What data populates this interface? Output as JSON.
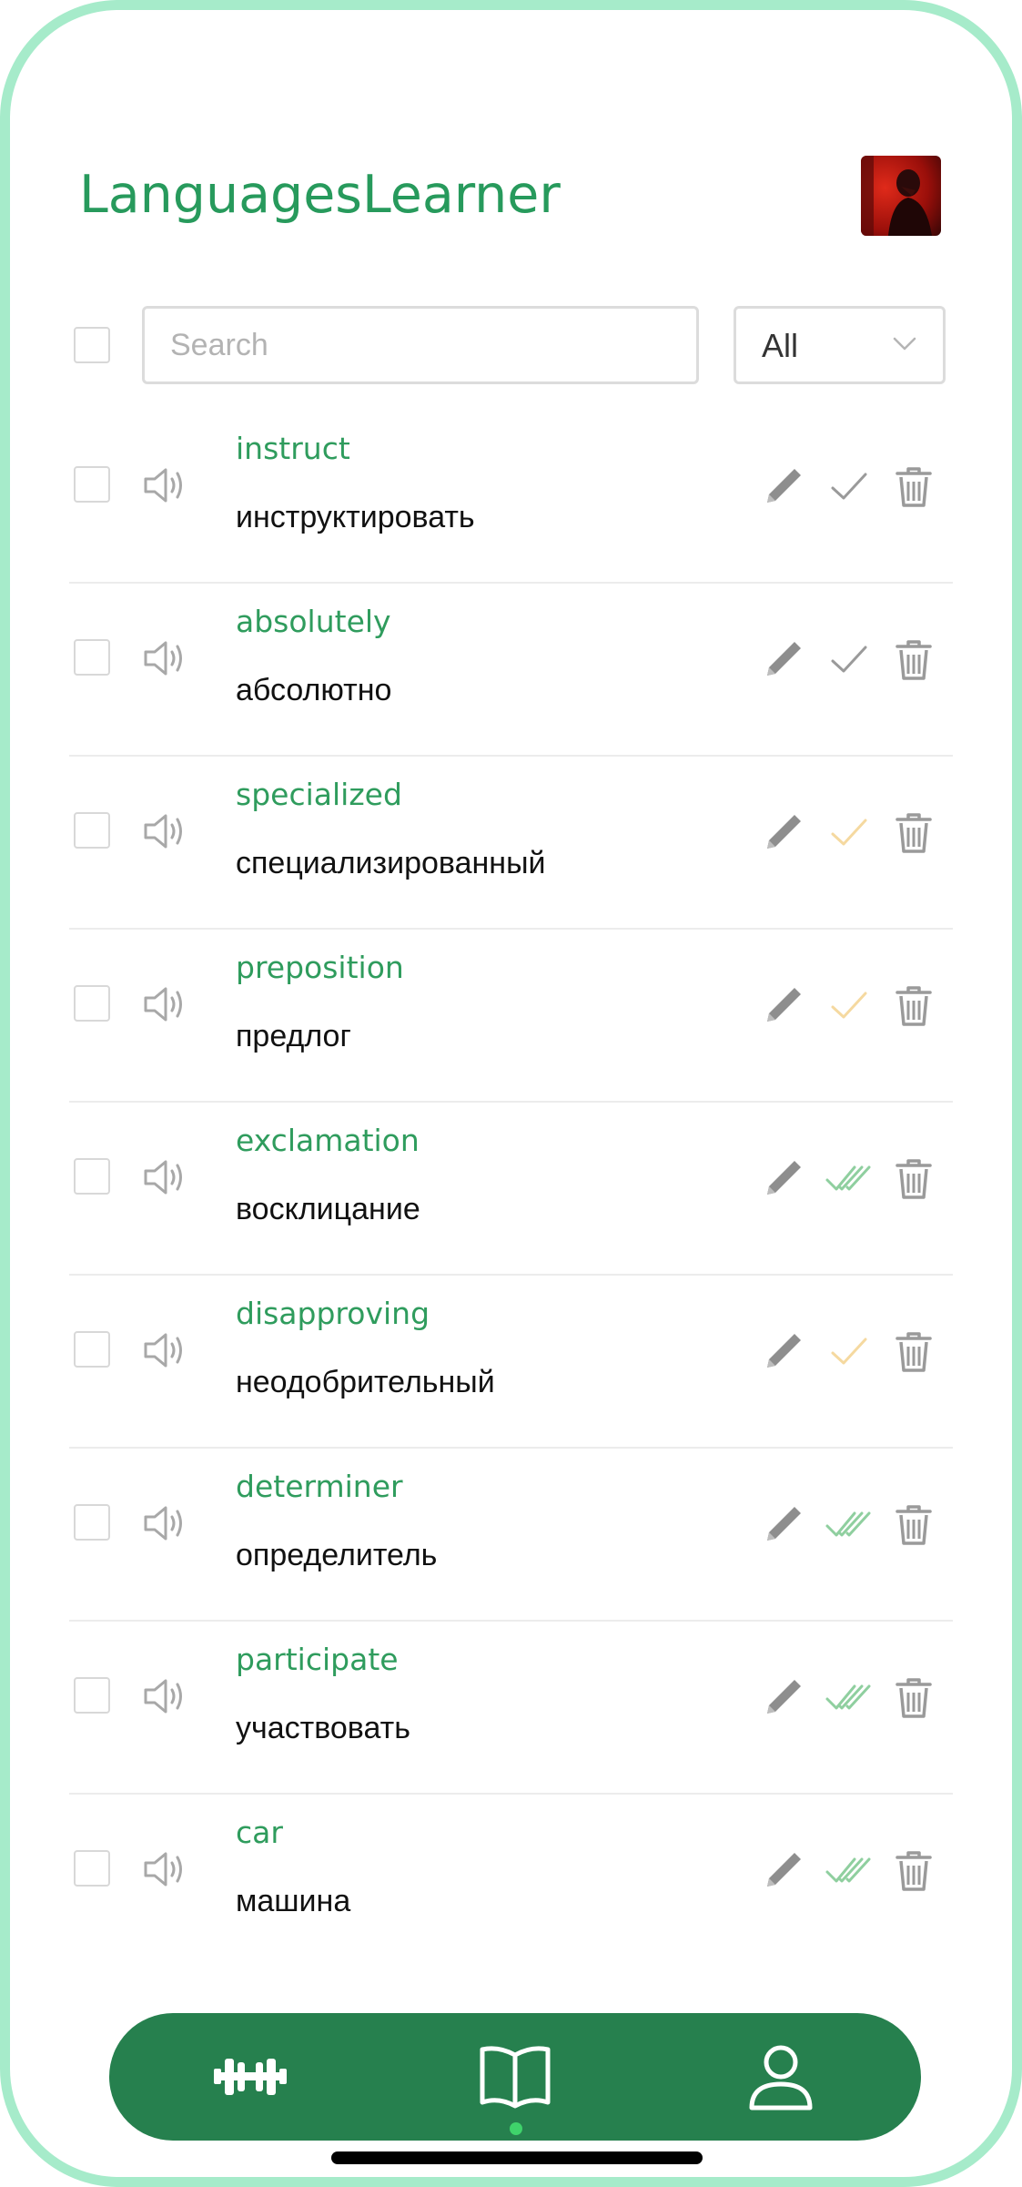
{
  "app": {
    "title": "LanguagesLearner",
    "avatar_icon": "user-avatar-photo"
  },
  "toolbar": {
    "search_placeholder": "Search",
    "search_value": "",
    "filter_value": "All"
  },
  "colors": {
    "brand_green": "#279a5c",
    "nav_background": "#26804e",
    "status_learned": "#8fcf9f",
    "status_in_progress": "#f5d9a0",
    "status_new": "#9a9a9a",
    "device_frame": "#a6ebca"
  },
  "words": [
    {
      "en": "instruct",
      "ru": "инструктировать",
      "status": "new"
    },
    {
      "en": "absolutely",
      "ru": "абсолютно",
      "status": "new"
    },
    {
      "en": "specialized",
      "ru": "специализированный",
      "status": "in-progress"
    },
    {
      "en": "preposition",
      "ru": "предлог",
      "status": "in-progress"
    },
    {
      "en": "exclamation",
      "ru": "восклицание",
      "status": "learned"
    },
    {
      "en": "disapproving",
      "ru": "неодобрительный",
      "status": "in-progress"
    },
    {
      "en": "determiner",
      "ru": "определитель",
      "status": "learned"
    },
    {
      "en": "participate",
      "ru": "участвовать",
      "status": "learned"
    },
    {
      "en": "car",
      "ru": "машина",
      "status": "learned"
    }
  ],
  "nav": {
    "items": [
      {
        "icon": "dumbbell-icon",
        "name": "training"
      },
      {
        "icon": "book-icon",
        "name": "dictionary"
      },
      {
        "icon": "user-icon",
        "name": "profile"
      }
    ],
    "active_index": 1
  }
}
